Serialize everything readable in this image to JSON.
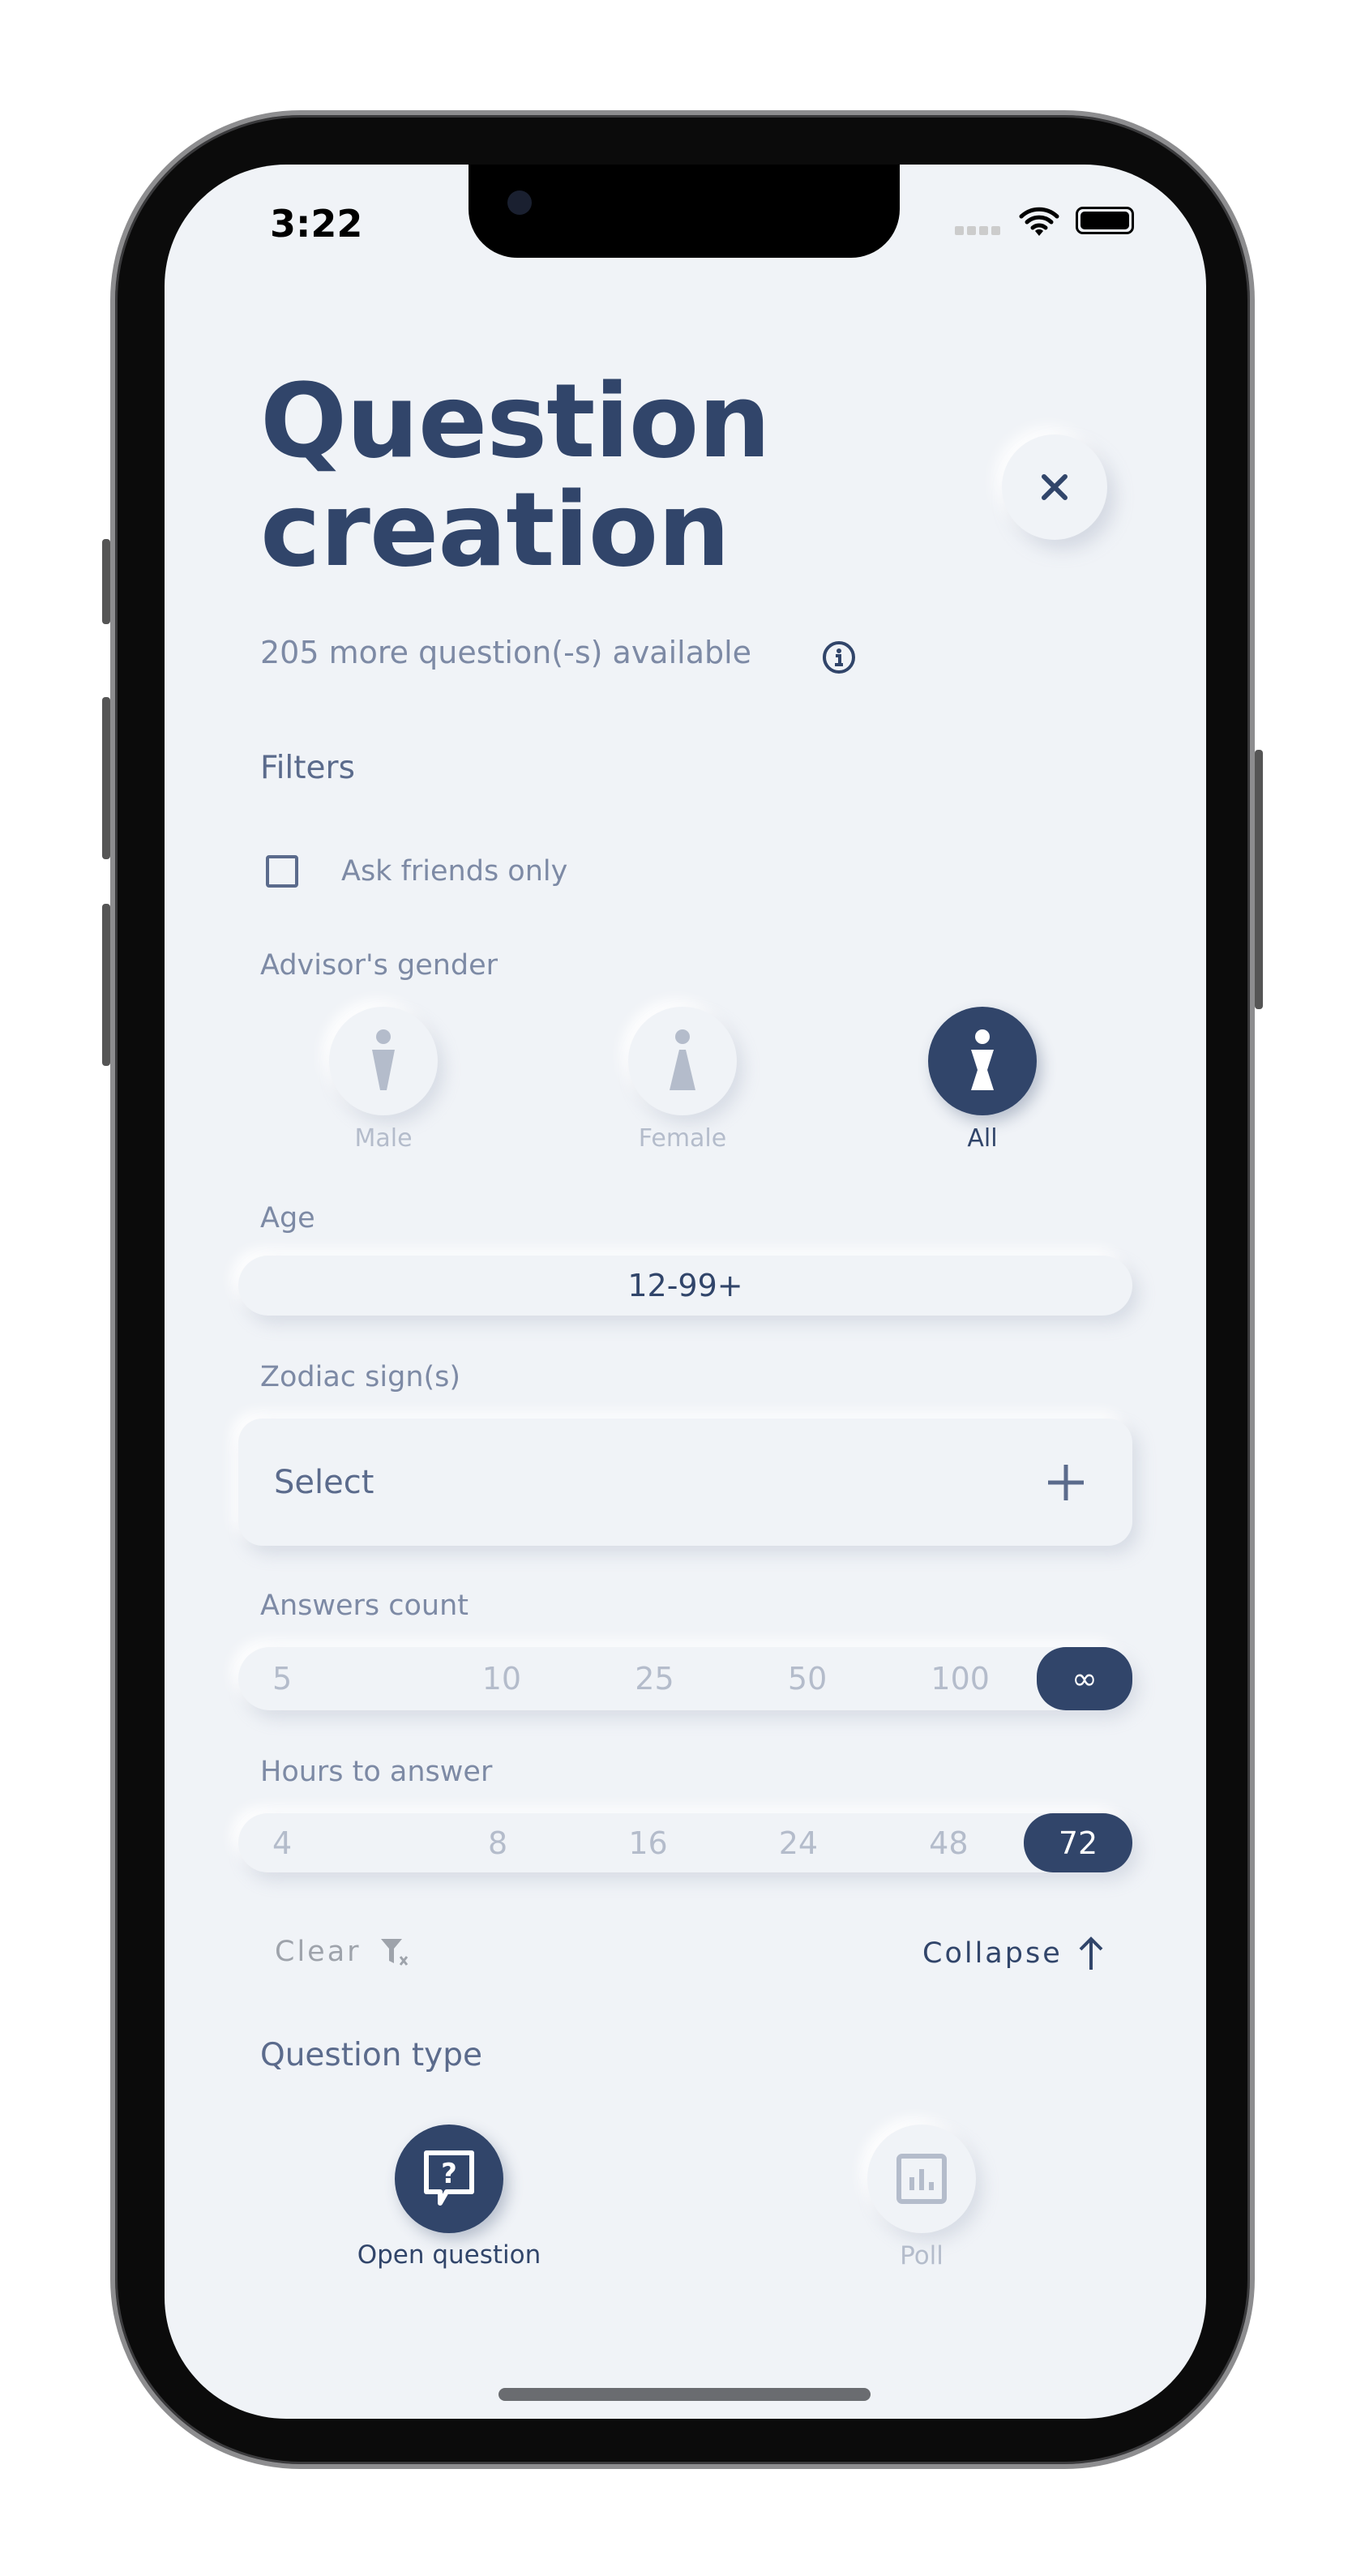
{
  "status_bar": {
    "time": "3:22"
  },
  "header": {
    "title_line1": "Question",
    "title_line2": "creation",
    "subtitle": "205 more question(-s) available"
  },
  "filters": {
    "heading": "Filters",
    "ask_friends_label": "Ask friends only",
    "ask_friends_checked": false,
    "gender_label": "Advisor's gender",
    "gender_options": [
      {
        "label": "Male",
        "selected": false
      },
      {
        "label": "Female",
        "selected": false
      },
      {
        "label": "All",
        "selected": true
      }
    ],
    "age_label": "Age",
    "age_value": "12-99+",
    "zodiac_label": "Zodiac sign(s)",
    "zodiac_placeholder": "Select",
    "answers_label": "Answers count",
    "answers_options": [
      "5",
      "10",
      "25",
      "50",
      "100",
      "∞"
    ],
    "answers_selected": "∞",
    "hours_label": "Hours to answer",
    "hours_options": [
      "4",
      "8",
      "16",
      "24",
      "48",
      "72"
    ],
    "hours_selected": "72",
    "clear_label": "Clear",
    "collapse_label": "Collapse"
  },
  "question_type": {
    "heading": "Question type",
    "options": [
      {
        "label": "Open question",
        "selected": true,
        "icon": "question-bubble-icon"
      },
      {
        "label": "Poll",
        "selected": false,
        "icon": "bar-chart-icon"
      }
    ]
  },
  "colors": {
    "primary": "#31456a",
    "muted": "#7d8aa5",
    "disabled": "#b4bccb",
    "background": "#f0f3f7"
  }
}
